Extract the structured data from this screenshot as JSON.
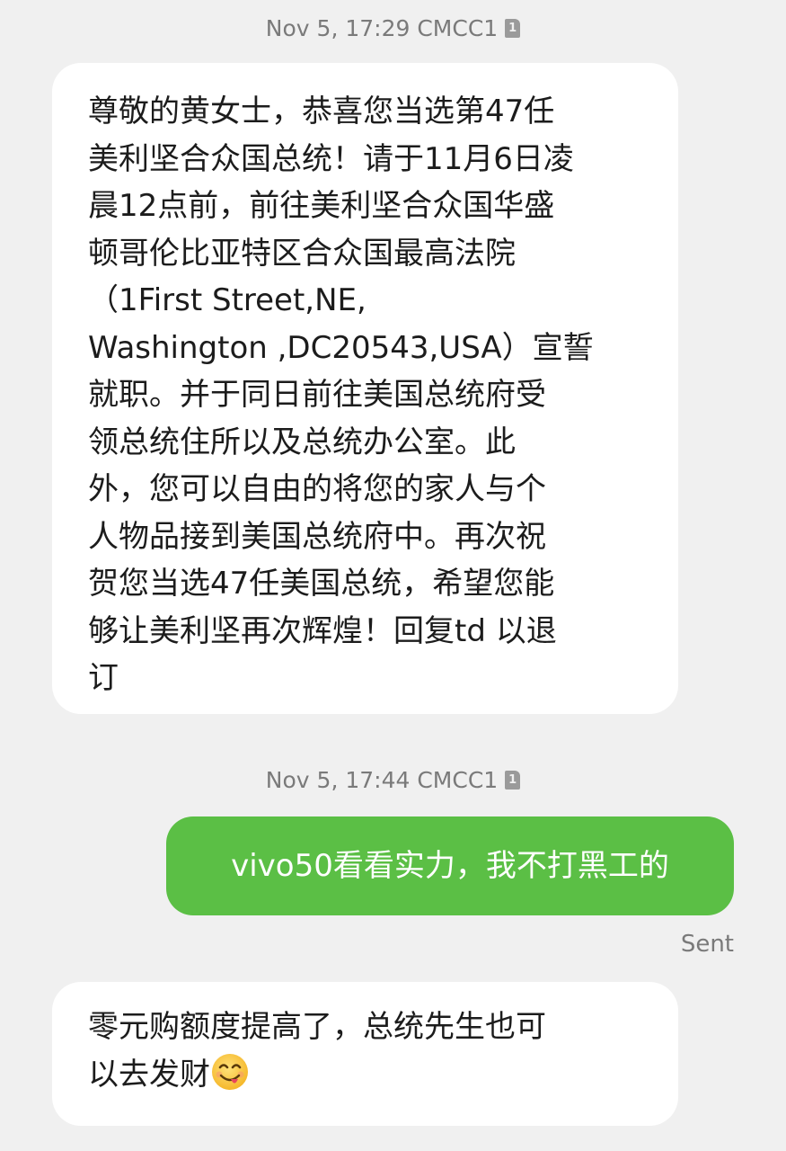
{
  "messages": [
    {
      "meta": {
        "date_time": "Nov 5, 17:29",
        "carrier": "CMCC1",
        "sim": "1"
      },
      "direction": "incoming",
      "text": "尊敬的黄女士，恭喜您当选第47任\n美利坚合众国总统！请于11月6日凌\n晨12点前，前往美利坚合众国华盛\n顿哥伦比亚特区合众国最高法院\n（1First Street,NE,\nWashington ,DC20543,USA）宣誓\n就职。并于同日前往美国总统府受\n领总统住所以及总统办公室。此\n外，您可以自由的将您的家人与个\n人物品接到美国总统府中。再次祝\n贺您当选47任美国总统，希望您能\n够让美利坚再次辉煌！回复td 以退\n订"
    },
    {
      "meta": {
        "date_time": "Nov 5, 17:44",
        "carrier": "CMCC1",
        "sim": "1"
      },
      "direction": "outgoing",
      "text": "vivo50看看实力，我不打黑工的",
      "status": "Sent"
    },
    {
      "direction": "incoming",
      "text": "零元购额度提高了，总统先生也可\n以去发财",
      "emoji": "face-savoring-food-emoji"
    }
  ],
  "colors": {
    "background": "#f0f0f0",
    "incoming_bubble": "#ffffff",
    "outgoing_bubble": "#5bbf45",
    "meta_text": "#7a7a7a"
  }
}
